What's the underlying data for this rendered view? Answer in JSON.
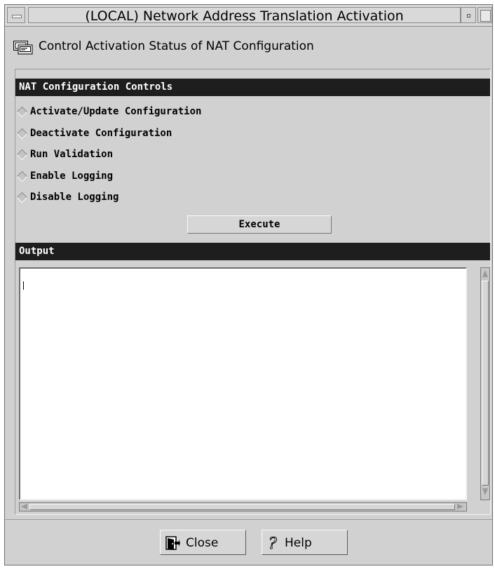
{
  "window": {
    "title": "(LOCAL) Network Address Translation Activation",
    "header": "Control Activation Status of NAT Configuration"
  },
  "controls": {
    "section_title": "NAT Configuration Controls",
    "options": [
      {
        "label": "Activate/Update Configuration"
      },
      {
        "label": "Deactivate Configuration"
      },
      {
        "label": "Run Validation"
      },
      {
        "label": "Enable Logging"
      },
      {
        "label": "Disable Logging"
      }
    ],
    "execute_label": "Execute"
  },
  "output": {
    "section_title": "Output",
    "text": ""
  },
  "footer": {
    "close_label": "Close",
    "help_label": "Help"
  },
  "icons": {
    "header": "console-window-icon",
    "close": "door-exit-icon",
    "help": "question-mark-icon"
  },
  "colors": {
    "window_bg": "#d1d1d1",
    "section_bar": "#1e1e1e",
    "section_text": "#ffffff",
    "output_bg": "#ffffff"
  }
}
